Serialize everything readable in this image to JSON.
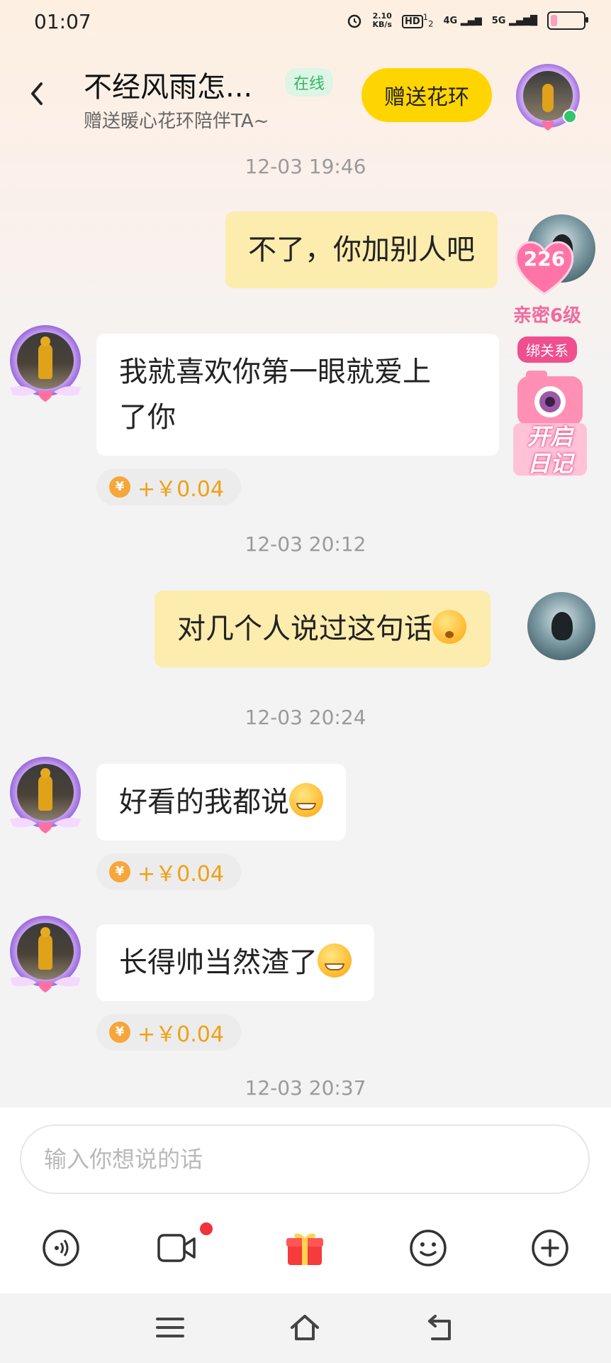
{
  "status_bar": {
    "time": "01:07",
    "net_speed_value": "2.10",
    "net_speed_unit": "KB/s",
    "hd": "HD",
    "hd_sim": "1",
    "hd_sim2": "2",
    "network_4g": "4G",
    "network_5g": "5G",
    "battery_level": 0.2
  },
  "header": {
    "title": "不经风雨怎...",
    "online_badge": "在线",
    "subtitle": "赠送暖心花环陪伴TA~",
    "gift_button": "赠送花环"
  },
  "intimacy": {
    "count": "226",
    "level": "亲密6级",
    "bind_label": "绑关系",
    "diary_line1": "开启",
    "diary_line2": "日记"
  },
  "messages": [
    {
      "type": "timestamp",
      "text": "12-03 19:46"
    },
    {
      "type": "outgoing",
      "text": "不了，你加别人吧"
    },
    {
      "type": "incoming",
      "text_line1": "我就喜欢你第一眼就爱上",
      "text_line2": "了你",
      "reward": "+￥0.04"
    },
    {
      "type": "timestamp",
      "text": "12-03 20:12"
    },
    {
      "type": "outgoing",
      "text": "对几个人说过这句话",
      "emoji": "flushed-emoji"
    },
    {
      "type": "timestamp",
      "text": "12-03 20:24"
    },
    {
      "type": "incoming",
      "text": "好看的我都说",
      "emoji": "smirk-emoji",
      "reward": "+￥0.04"
    },
    {
      "type": "incoming",
      "text": "长得帅当然渣了",
      "emoji": "smirk-emoji",
      "reward": "+￥0.04"
    },
    {
      "type": "timestamp",
      "text": "12-03 20:37"
    }
  ],
  "composer": {
    "placeholder": "输入你想说的话",
    "toolbar": [
      "voice-icon",
      "video-call-icon",
      "gift-box-icon",
      "emoji-icon",
      "plus-icon"
    ]
  },
  "colors": {
    "outgoing_bubble": "#fcecae",
    "incoming_bubble": "#ffffff",
    "accent_yellow": "#ffd500",
    "online_green": "#35b563",
    "reward_orange": "#f0a015",
    "intimacy_pink": "#f06a9e"
  }
}
